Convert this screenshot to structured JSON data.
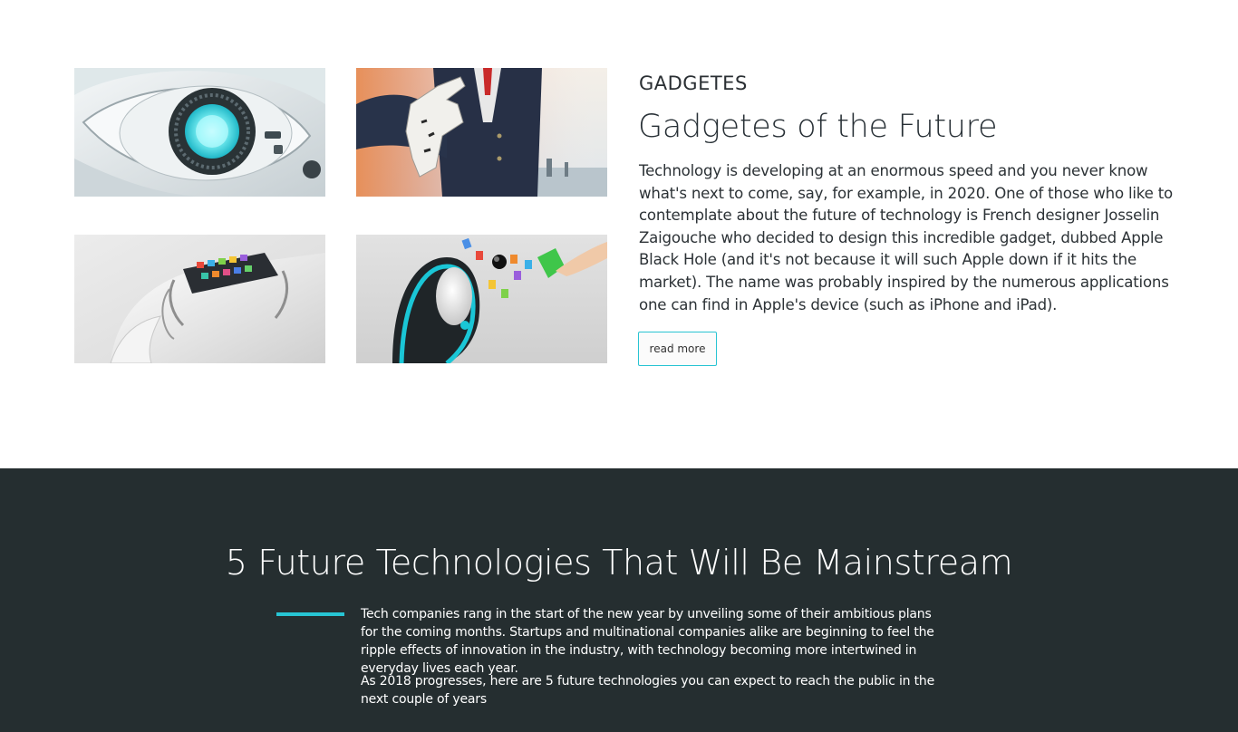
{
  "gadgets_section": {
    "category": "GADGETES",
    "title": "Gadgetes of the Future",
    "description": "Technology is developing at an enormous speed and you never know what's next to come, say, for example, in 2020. One of those who like to contemplate about the future of technology is French designer Josselin Zaigouche who decided to design this incredible gadget, dubbed Apple Black Hole (and it's not because it will such Apple down if it hits the market). The name was probably inspired by the numerous applications one can find in Apple's device (such as iPhone and iPad).",
    "read_more_label": "read more",
    "accent_color": "#27c5d4"
  },
  "images": [
    {
      "icon": "robot-eye-image"
    },
    {
      "icon": "robotic-hand-handshake-image"
    },
    {
      "icon": "wrist-device-image"
    },
    {
      "icon": "apple-black-hole-gadget-image"
    }
  ],
  "future_tech_section": {
    "title": "5 Future Technologies That Will Be Mainstream",
    "paragraphs": [
      "Tech companies rang in the start of the new year by unveiling some of their ambitious plans for the coming months. Startups and multinational companies alike are beginning to feel the ripple effects of innovation in the industry, with technology becoming more intertwined in everyday lives each year.",
      "As 2018 progresses, here are 5 future technologies you can expect to reach the public in the next couple of years"
    ],
    "background_color": "#252e30"
  }
}
